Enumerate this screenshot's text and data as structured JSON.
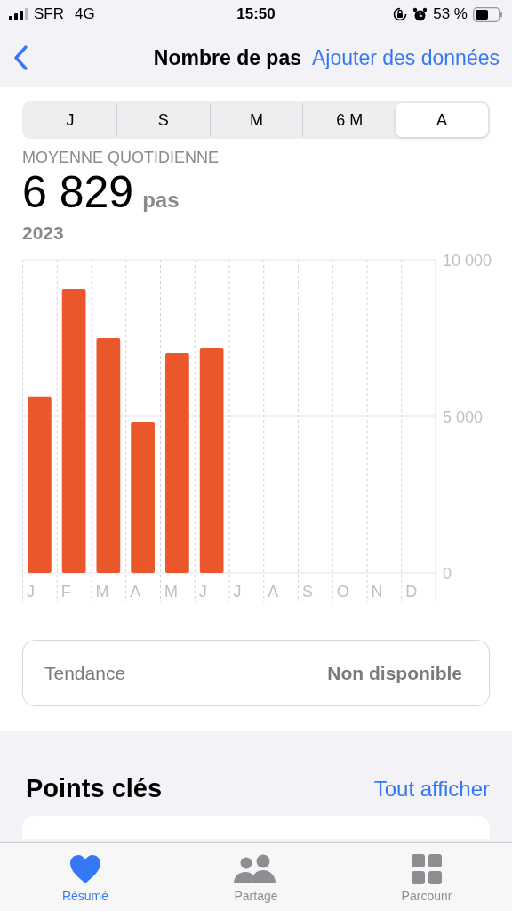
{
  "status_bar": {
    "carrier": "SFR",
    "network": "4G",
    "time": "15:50",
    "battery": "53 %"
  },
  "nav": {
    "title": "Nombre de pas",
    "action": "Ajouter des données"
  },
  "ranges": [
    {
      "label": "J",
      "selected": false
    },
    {
      "label": "S",
      "selected": false
    },
    {
      "label": "M",
      "selected": false
    },
    {
      "label": "6 M",
      "selected": false
    },
    {
      "label": "A",
      "selected": true
    }
  ],
  "summary": {
    "label": "MOYENNE QUOTIDIENNE",
    "value": "6 829",
    "unit": "pas",
    "period": "2023"
  },
  "chart_data": {
    "type": "bar",
    "categories": [
      "J",
      "F",
      "M",
      "A",
      "M",
      "J",
      "J",
      "A",
      "S",
      "O",
      "N",
      "D"
    ],
    "series": [
      {
        "color": "#e9572a",
        "values": [
          5630,
          9060,
          7500,
          4830,
          7020,
          7190,
          null,
          null,
          null,
          null,
          null,
          null
        ]
      }
    ],
    "ylim": [
      0,
      10000
    ],
    "yticks": [
      {
        "value": 0,
        "label": "0"
      },
      {
        "value": 5000,
        "label": "5 000"
      },
      {
        "value": 10000,
        "label": "10 000"
      }
    ]
  },
  "trend": {
    "label": "Tendance",
    "value": "Non disponible"
  },
  "highlights": {
    "title": "Points clés",
    "link": "Tout afficher"
  },
  "tabs": [
    {
      "label": "Résumé",
      "selected": true
    },
    {
      "label": "Partage",
      "selected": false
    },
    {
      "label": "Parcourir",
      "selected": false
    }
  ]
}
